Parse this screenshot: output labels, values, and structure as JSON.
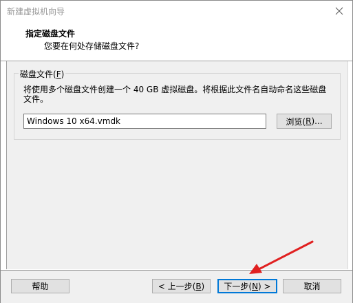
{
  "window": {
    "title": "新建虚拟机向导"
  },
  "header": {
    "title": "指定磁盘文件",
    "subtitle": "您要在何处存储磁盘文件?"
  },
  "disk_file_group": {
    "legend": "磁盘文件(F)",
    "legend_prefix": "磁盘文件(",
    "legend_key": "F",
    "legend_suffix": ")",
    "description": "将使用多个磁盘文件创建一个 40 GB 虚拟磁盘。将根据此文件名自动命名这些磁盘文件。",
    "file_value": "Windows 10 x64.vmdk",
    "browse_prefix": "浏览(",
    "browse_key": "R",
    "browse_suffix": ")..."
  },
  "footer": {
    "help_label": "帮助",
    "back_prefix": "< 上一步(",
    "back_key": "B",
    "back_suffix": ")",
    "next_prefix": "下一步(",
    "next_key": "N",
    "next_suffix": ") >",
    "cancel_label": "取消"
  },
  "annotation": {
    "arrow_color": "#e02020"
  },
  "colors": {
    "focus_border": "#0078d7",
    "panel_bg": "#f0f0f0"
  }
}
